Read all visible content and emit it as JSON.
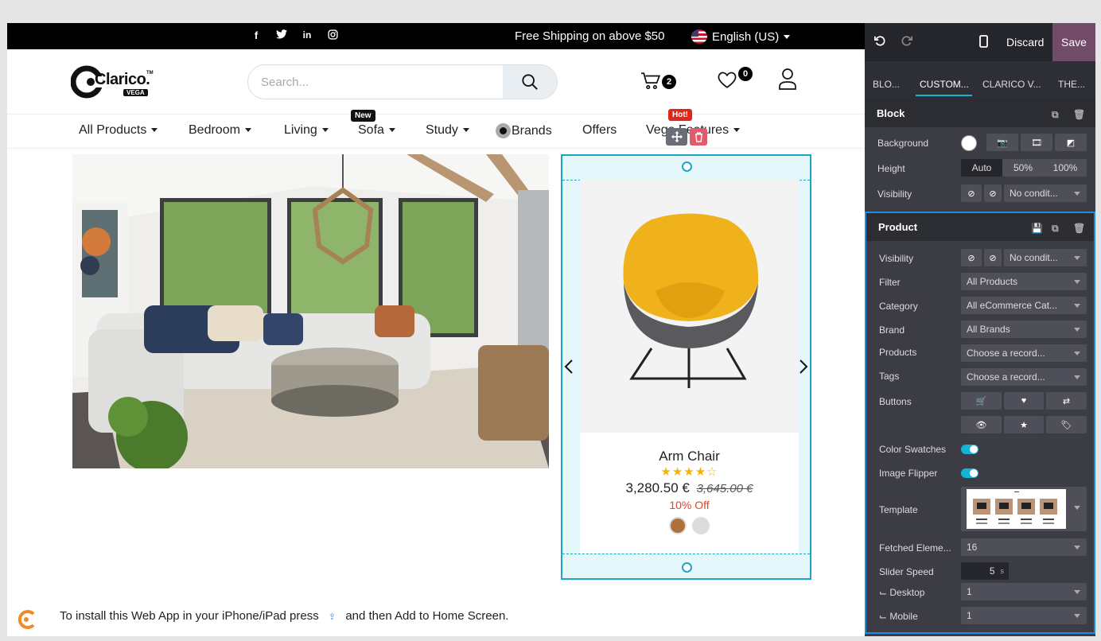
{
  "topbar": {
    "social": [
      "f",
      "t",
      "in",
      "ig"
    ],
    "shipping": "Free Shipping on above $50",
    "language": "English (US)"
  },
  "header": {
    "logo_text": "Clarico.",
    "logo_tm": "TM",
    "logo_sub": "VEGA",
    "search_placeholder": "Search...",
    "cart_count": "2",
    "wishlist_count": "0"
  },
  "nav": {
    "items": [
      {
        "label": "All Products",
        "caret": true
      },
      {
        "label": "Bedroom",
        "caret": true
      },
      {
        "label": "Living",
        "caret": true
      },
      {
        "label": "Sofa",
        "caret": true,
        "tag": "New"
      },
      {
        "label": "Study",
        "caret": true
      },
      {
        "label": "Brands",
        "caret": false
      },
      {
        "label": "Offers",
        "caret": false
      },
      {
        "label": "Vega Features",
        "caret": true,
        "tag": "Hot!"
      }
    ]
  },
  "product": {
    "name": "Arm Chair",
    "stars": "★★★★☆",
    "rating": 4,
    "price": "3,280.50 €",
    "old_price": "3,645.00 €",
    "discount": "10% Off",
    "swatch_colors": [
      "#b0703c",
      "#dcdcdc"
    ]
  },
  "install": {
    "text_before": "To install this Web App in your iPhone/iPad press",
    "text_after": "and then Add to Home Screen."
  },
  "editor": {
    "discard": "Discard",
    "save": "Save",
    "tabs": [
      "BLO...",
      "CUSTOM...",
      "CLARICO V...",
      "THE..."
    ],
    "block": {
      "title": "Block",
      "background_label": "Background",
      "height_label": "Height",
      "height_options": [
        "Auto",
        "50%",
        "100%"
      ],
      "visibility_label": "Visibility",
      "visibility_value": "No condit..."
    },
    "product": {
      "title": "Product",
      "visibility_label": "Visibility",
      "visibility_value": "No condit...",
      "filter_label": "Filter",
      "filter_value": "All Products",
      "category_label": "Category",
      "category_value": "All eCommerce Cat...",
      "brand_label": "Brand",
      "brand_value": "All Brands",
      "products_label": "Products",
      "products_value": "Choose a record...",
      "tags_label": "Tags",
      "tags_value": "Choose a record...",
      "buttons_label": "Buttons",
      "color_swatches_label": "Color Swatches",
      "image_flipper_label": "Image Flipper",
      "template_label": "Template",
      "fetched_label": "Fetched Eleme...",
      "fetched_value": "16",
      "slider_speed_label": "Slider Speed",
      "slider_speed_value": "5",
      "slider_speed_unit": "s",
      "desktop_label": "⌙ Desktop",
      "desktop_value": "1",
      "mobile_label": "⌙ Mobile",
      "mobile_value": "1"
    }
  },
  "colors": {
    "accent": "#20a4c6",
    "save_bg": "#714b67",
    "panel_bg": "#3b3c44",
    "discount": "#e2431f",
    "star": "#f5b400"
  }
}
